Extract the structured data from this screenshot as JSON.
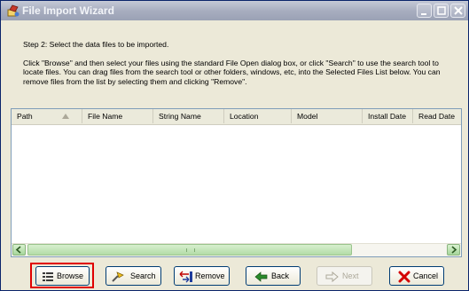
{
  "window": {
    "title": "File Import Wizard",
    "controls": [
      "minimize-icon",
      "maximize-icon",
      "close-icon"
    ]
  },
  "instructions": {
    "step": "Step 2: Select the data files to be imported.",
    "description": "Click \"Browse\"  and then select your files using the standard File Open dialog box, or click \"Search\" to use the search tool to locate files. You can drag files from the search tool or other folders, windows, etc, into the Selected Files List below. You can remove files from the list by selecting them and clicking \"Remove\"."
  },
  "file_list": {
    "columns": [
      "Path",
      "File Name",
      "String Name",
      "Location",
      "Model",
      "Install Date",
      "Read Date"
    ],
    "rows": []
  },
  "buttons": {
    "browse": "Browse",
    "search": "Search",
    "remove": "Remove",
    "back": "Back",
    "next": "Next",
    "cancel": "Cancel"
  },
  "colors": {
    "focus_highlight": "#e00000",
    "cancel_icon": "#d40000"
  }
}
